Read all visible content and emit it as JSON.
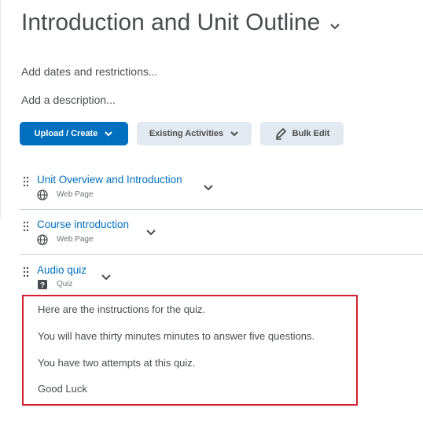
{
  "module": {
    "title": "Introduction and Unit Outline",
    "add_dates": "Add dates and restrictions...",
    "add_description": "Add a description..."
  },
  "toolbar": {
    "upload_create": "Upload / Create",
    "existing_activities": "Existing Activities",
    "bulk_edit": "Bulk Edit"
  },
  "items": [
    {
      "title": "Unit Overview and Introduction",
      "type": "Web Page",
      "icon": "globe-icon"
    },
    {
      "title": "Course introduction",
      "type": "Web Page",
      "icon": "globe-icon"
    },
    {
      "title": "Audio quiz",
      "type": "Quiz",
      "icon": "quiz-icon"
    }
  ],
  "quiz_description": [
    "Here are the instructions for the quiz.",
    "You will have thirty minutes minutes to  answer five questions.",
    "You have two attempts at this quiz.",
    "Good Luck"
  ],
  "colors": {
    "primary": "#006fbf",
    "link": "#006fbf",
    "highlight_border": "#d0202d",
    "secondary_button": "#e3e9f1"
  }
}
